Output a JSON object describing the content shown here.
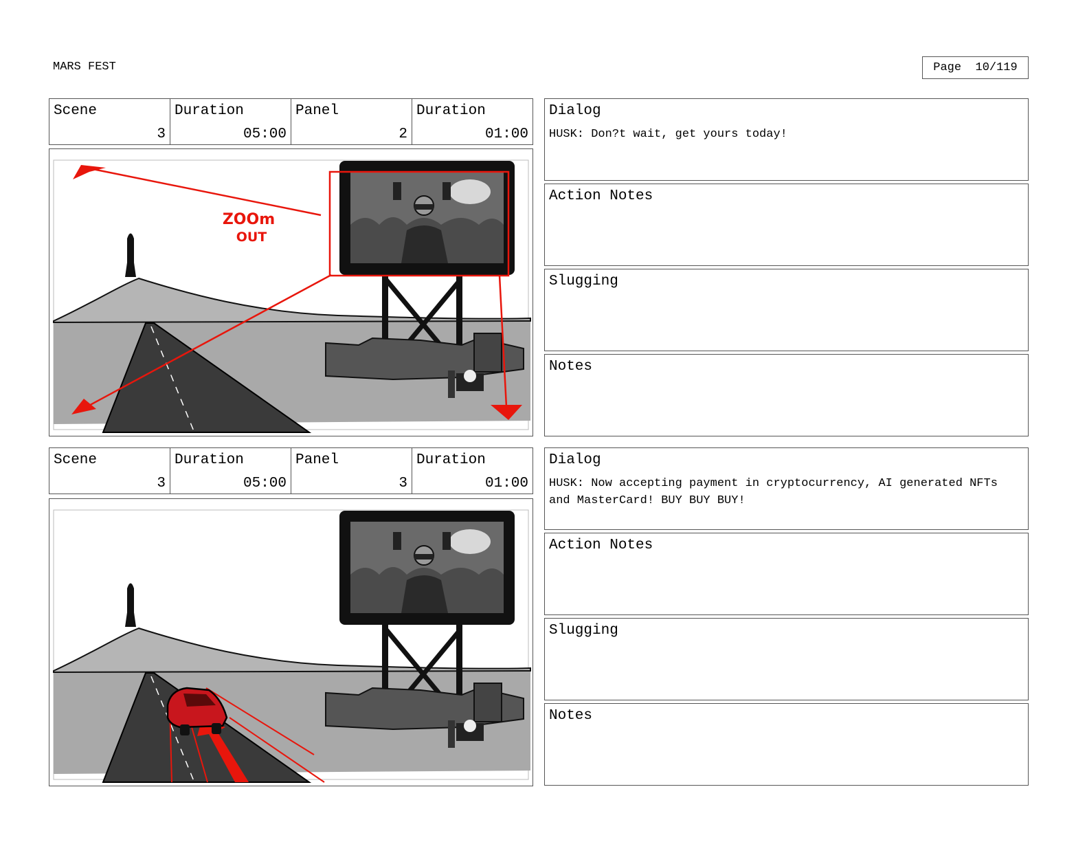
{
  "project": {
    "title": "MARS FEST"
  },
  "page": {
    "label": "Page  10/119"
  },
  "panels": [
    {
      "scene_label": "Scene",
      "scene": "3",
      "scene_duration_label": "Duration",
      "scene_duration": "05:00",
      "panel_label": "Panel",
      "panel": "2",
      "panel_duration_label": "Duration",
      "panel_duration": "01:00",
      "annotation_line1": "ZOOm",
      "annotation_line2": "OUT",
      "dialog_label": "Dialog",
      "dialog": "HUSK: Don?t wait, get yours today!",
      "action_notes_label": "Action Notes",
      "action_notes": "",
      "slugging_label": "Slugging",
      "slugging": "",
      "notes_label": "Notes",
      "notes": ""
    },
    {
      "scene_label": "Scene",
      "scene": "3",
      "scene_duration_label": "Duration",
      "scene_duration": "05:00",
      "panel_label": "Panel",
      "panel": "3",
      "panel_duration_label": "Duration",
      "panel_duration": "01:00",
      "dialog_label": "Dialog",
      "dialog": "HUSK: Now accepting payment in cryptocurrency, AI generated NFTs and MasterCard! BUY BUY BUY!",
      "action_notes_label": "Action Notes",
      "action_notes": "",
      "slugging_label": "Slugging",
      "slugging": "",
      "notes_label": "Notes",
      "notes": ""
    }
  ],
  "colors": {
    "annotation_red": "#e8160c",
    "car_red": "#c8161d",
    "ground_gray": "#a9a9a9",
    "road_dark": "#3a3a3a"
  }
}
